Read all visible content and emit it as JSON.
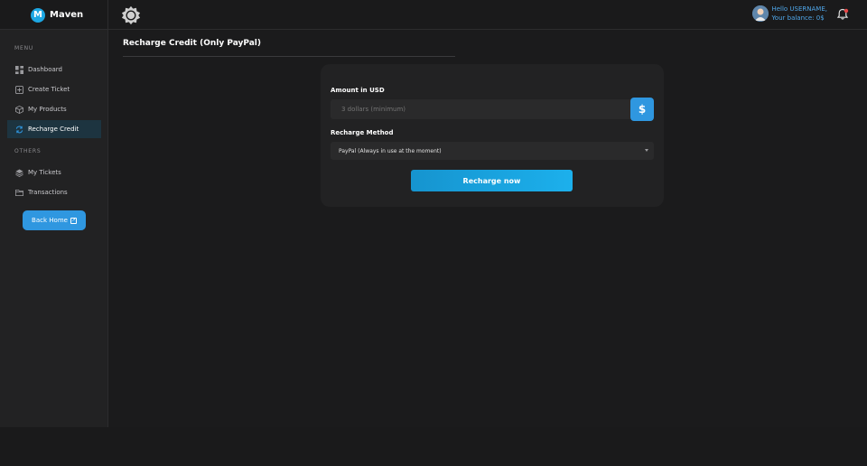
{
  "brand": {
    "logo_letter": "M",
    "name": "Maven"
  },
  "user": {
    "greeting": "Hello USERNAME,",
    "balance": "Your balance: 0$"
  },
  "sidebar": {
    "menu_label": "MENU",
    "menu_items": [
      {
        "label": "Dashboard",
        "icon": "dashboard-icon"
      },
      {
        "label": "Create Ticket",
        "icon": "plus-square-icon"
      },
      {
        "label": "My Products",
        "icon": "box-icon"
      },
      {
        "label": "Recharge Credit",
        "icon": "refresh-icon",
        "active": true
      }
    ],
    "others_label": "OTHERS",
    "other_items": [
      {
        "label": "My Tickets",
        "icon": "layers-icon"
      },
      {
        "label": "Transactions",
        "icon": "folder-icon"
      }
    ],
    "back_home_label": "Back Home"
  },
  "page": {
    "title": "Recharge Credit (Only PayPal)"
  },
  "form": {
    "amount_label": "Amount in USD",
    "amount_placeholder": "3 dollars (minimum)",
    "currency_symbol": "$",
    "method_label": "Recharge Method",
    "method_selected": "PayPal (Always in use at the moment)",
    "submit_label": "Recharge now"
  },
  "colors": {
    "accent": "#2f97e0",
    "button_gradient_start": "#1694cf",
    "button_gradient_end": "#1cb0ec",
    "active_nav_bg": "#1d3440"
  }
}
